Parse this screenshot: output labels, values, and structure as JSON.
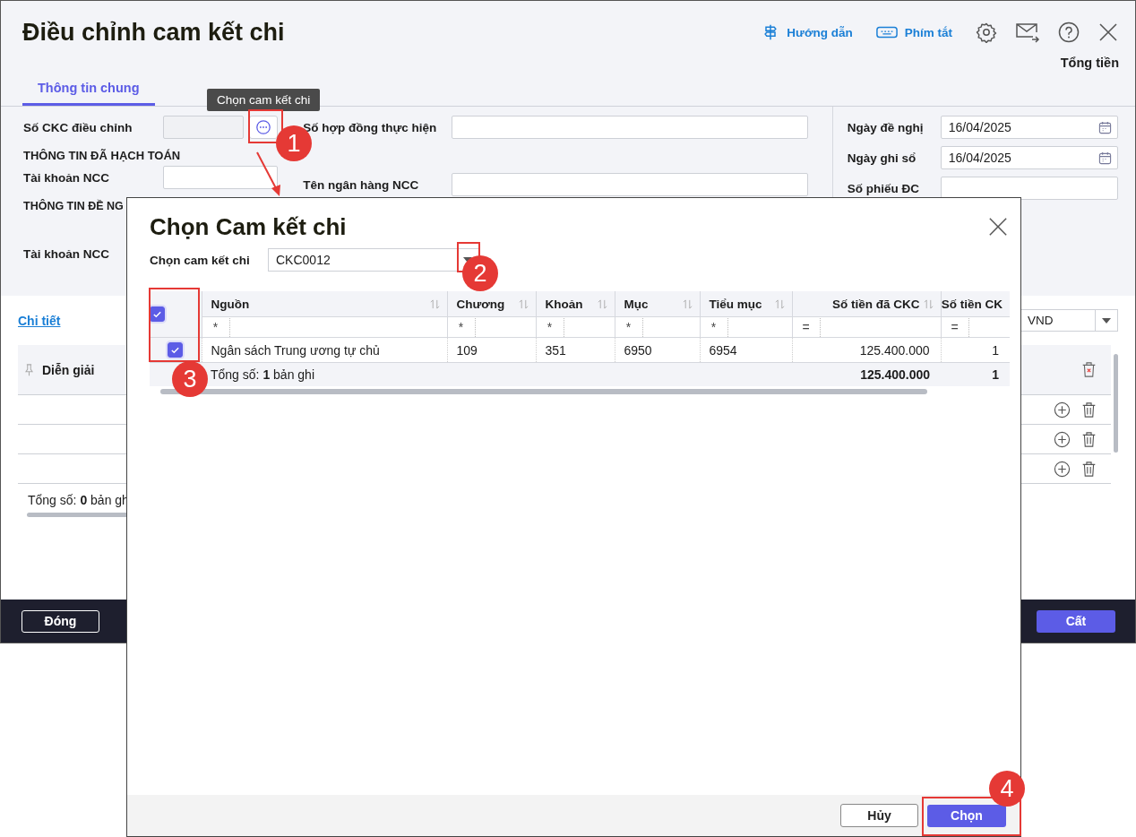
{
  "window": {
    "title": "Điều chỉnh cam kết chi",
    "total_label": "Tổng tiền"
  },
  "toolbar": [
    {
      "kind": "guide",
      "label": "Hướng dẫn"
    },
    {
      "kind": "shortcuts",
      "label": "Phím tắt"
    },
    {
      "kind": "settings"
    },
    {
      "kind": "mail"
    },
    {
      "kind": "help"
    },
    {
      "kind": "close"
    }
  ],
  "tabs": [
    {
      "label": "Thông tin chung",
      "selected": true
    }
  ],
  "tooltip": "Chọn cam kết chi",
  "form": {
    "left": [
      {
        "kind": "picker",
        "label": "Số CKC điều chỉnh"
      },
      {
        "kind": "heading",
        "label": "THÔNG TIN ĐÃ HẠCH TOÁN"
      },
      {
        "kind": "field",
        "label": "Tài khoản NCC"
      },
      {
        "kind": "heading",
        "label": "THÔNG TIN ĐỀ NG"
      },
      {
        "kind": "field",
        "label": "Tài khoản NCC"
      }
    ],
    "middle": [
      {
        "kind": "field",
        "label": "Số hợp đồng thực hiện"
      },
      {
        "kind": "field",
        "label": "Tên ngân hàng NCC"
      }
    ],
    "right": [
      {
        "kind": "date",
        "label": "Ngày đề nghị",
        "value": "16/04/2025"
      },
      {
        "kind": "date",
        "label": "Ngày ghi sổ",
        "value": "16/04/2025"
      },
      {
        "kind": "field",
        "label": "Số phiếu ĐC"
      }
    ]
  },
  "detail": {
    "link": "Chi tiết",
    "currency": "VND",
    "column": "Diễn giải",
    "rows": [
      {
        "kind": "empty"
      },
      {
        "kind": "empty"
      },
      {
        "kind": "empty"
      }
    ],
    "total": "Tổng số: **0** bản gh"
  },
  "footer": {
    "close": "Đóng",
    "save": "Cất"
  },
  "dialog": {
    "title": "Chọn Cam kết chi",
    "select_label": "Chọn cam kết chi",
    "select_value": "CKC0012",
    "all_checked": true,
    "columns": [
      {
        "label": "Nguồn",
        "filter": "*",
        "kind": "text"
      },
      {
        "label": "Chương",
        "filter": "*",
        "kind": "text"
      },
      {
        "label": "Khoản",
        "filter": "*",
        "kind": "text"
      },
      {
        "label": "Mục",
        "filter": "*",
        "kind": "text"
      },
      {
        "label": "Tiểu mục",
        "filter": "*",
        "kind": "text"
      },
      {
        "label": "Số tiền đã CKC",
        "filter": "=",
        "kind": "amount"
      },
      {
        "label": "Số tiền CK",
        "filter": "=",
        "kind": "amount"
      }
    ],
    "rows": [
      {
        "checked": true,
        "cells": [
          "Ngân sách Trung ương tự chủ",
          "109",
          "351",
          "6950",
          "6954",
          "125.400.000",
          "1"
        ]
      }
    ],
    "total_label": "Tổng số: **1** bản ghi",
    "totals": [
      "125.400.000",
      "1"
    ],
    "cancel": "Hủy",
    "confirm": "Chọn"
  },
  "annotations": [
    {
      "number": "1"
    },
    {
      "number": "2"
    },
    {
      "number": "3"
    },
    {
      "number": "4"
    }
  ]
}
